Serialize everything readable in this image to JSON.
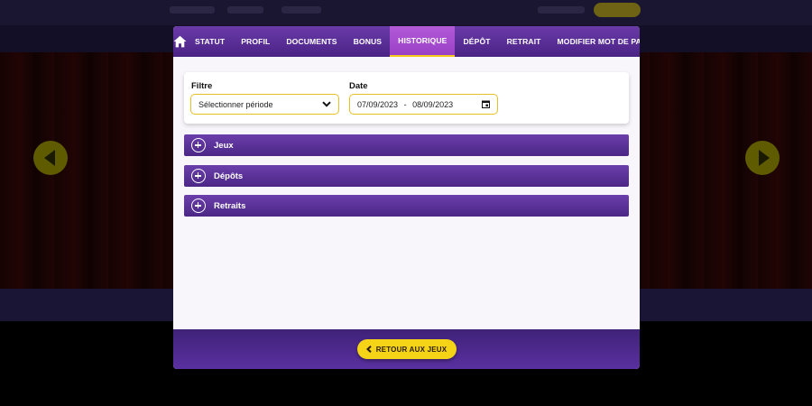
{
  "nav": {
    "home_icon": "home-icon",
    "tabs": [
      {
        "label": "STATUT"
      },
      {
        "label": "PROFIL"
      },
      {
        "label": "DOCUMENTS"
      },
      {
        "label": "BONUS"
      },
      {
        "label": "HISTORIQUE",
        "active": true
      },
      {
        "label": "DÉPÔT"
      },
      {
        "label": "RETRAIT"
      },
      {
        "label": "MODIFIER MOT DE PASSE"
      }
    ]
  },
  "filter": {
    "filter_label": "Filtre",
    "select_value": "Sélectionner période",
    "date_label": "Date",
    "date_from": "07/09/2023",
    "date_sep": "-",
    "date_to": "08/09/2023"
  },
  "sections": [
    {
      "label": "Jeux"
    },
    {
      "label": "Dépôts"
    },
    {
      "label": "Retraits"
    }
  ],
  "footer": {
    "back_label": "RETOUR AUX JEUX"
  },
  "colors": {
    "accent_purple": "#5a2f9a",
    "active_tab": "#a64bd0",
    "button_yellow": "#f5d317",
    "input_border": "#e6c028"
  }
}
